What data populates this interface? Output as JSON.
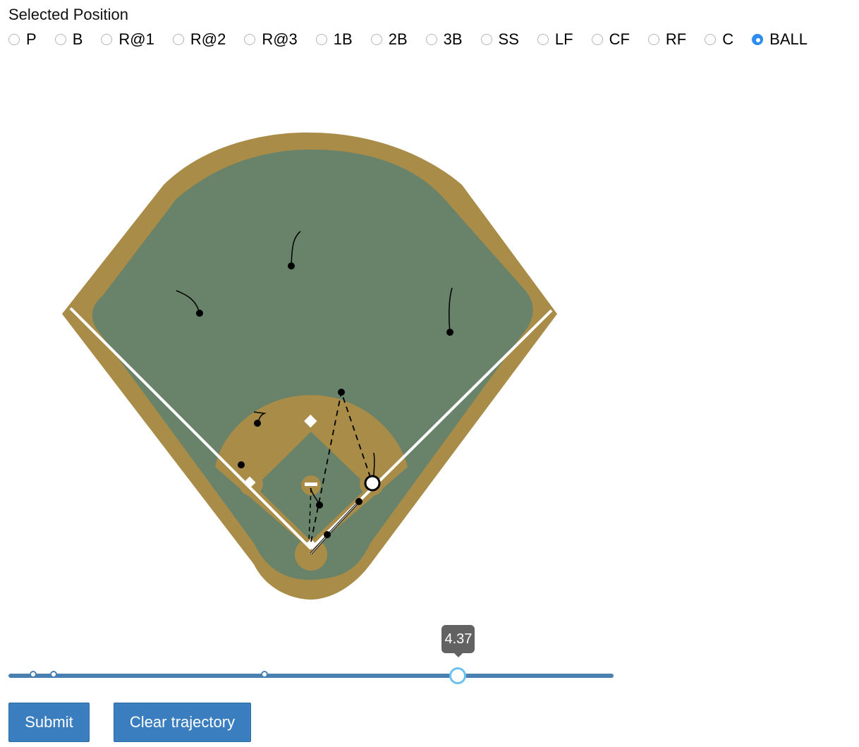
{
  "position_selector": {
    "label": "Selected Position",
    "options": [
      "P",
      "B",
      "R@1",
      "R@2",
      "R@3",
      "1B",
      "2B",
      "3B",
      "SS",
      "LF",
      "CF",
      "RF",
      "C",
      "BALL"
    ],
    "selected": "BALL"
  },
  "field": {
    "colors": {
      "dirt": "#a88c47",
      "grass": "#68836a",
      "lines": "#ffffff",
      "marker": "#000000"
    },
    "players": [
      "CF",
      "LF",
      "RF",
      "SS",
      "2B",
      "3B",
      "P",
      "1B",
      "C",
      "BALL"
    ]
  },
  "timeline": {
    "current_time_label": "4.37",
    "current_fraction": 0.743,
    "keyframe_fractions": [
      0.041,
      0.075,
      0.423
    ]
  },
  "actions": {
    "submit_label": "Submit",
    "clear_label": "Clear trajectory"
  }
}
